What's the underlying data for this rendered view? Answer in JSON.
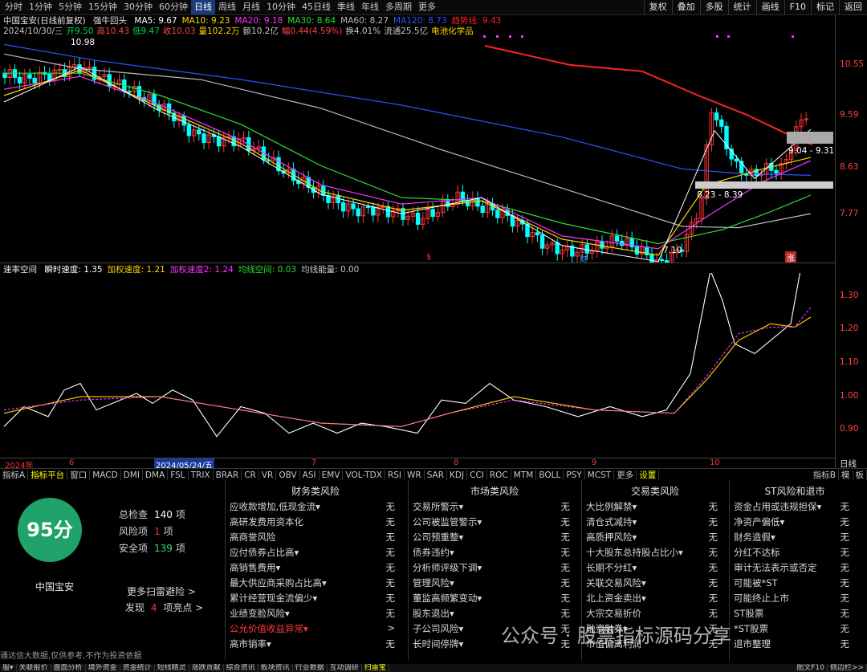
{
  "toolbar": {
    "periods": [
      "分时",
      "1分钟",
      "5分钟",
      "15分钟",
      "30分钟",
      "60分钟",
      "日线",
      "周线",
      "月线",
      "10分钟",
      "45日线",
      "季线",
      "年线",
      "多周期",
      "更多"
    ],
    "active_period": "日线",
    "right_tools": [
      "复权",
      "叠加",
      "多股",
      "统计",
      "画线",
      "F10",
      "标记",
      "返回"
    ]
  },
  "legend": {
    "stock_title": "中国宝安(日线前复权)",
    "signal": "强牛回头",
    "ma": [
      {
        "label": "MA5: 9.67",
        "color": "#ffffff"
      },
      {
        "label": "MA10: 9.23",
        "color": "#ffd700"
      },
      {
        "label": "MA20: 9.18",
        "color": "#ff33ff"
      },
      {
        "label": "MA30: 8.64",
        "color": "#33dd33"
      },
      {
        "label": "MA60: 8.27",
        "color": "#bbbbbb"
      },
      {
        "label": "MA120: 8.73",
        "color": "#2a55ff"
      },
      {
        "label": "趋势线: 9.43",
        "color": "#ff2222"
      }
    ],
    "ohlc": [
      {
        "t": "2024/10/30/三",
        "c": "#c8c8c8"
      },
      {
        "t": "开9.50",
        "c": "#00dd44"
      },
      {
        "t": "高10.43",
        "c": "#ff4444"
      },
      {
        "t": "低9.47",
        "c": "#00dd44"
      },
      {
        "t": "收10.03",
        "c": "#ff4444"
      },
      {
        "t": "量102.2万",
        "c": "#ffd700"
      },
      {
        "t": "额10.2亿",
        "c": "#c8c8c8"
      },
      {
        "t": "幅0.44(4.59%)",
        "c": "#ff4444"
      },
      {
        "t": "换4.01%",
        "c": "#c8c8c8"
      },
      {
        "t": "流通25.5亿",
        "c": "#c8c8c8"
      },
      {
        "t": "电池化学品",
        "c": "#ffd700"
      }
    ]
  },
  "price_axis": {
    "labels": [
      "10.55",
      "9.59",
      "8.63",
      "7.77"
    ]
  },
  "annotations": {
    "high_label": "10.98",
    "low_label": "7.10",
    "box1": "9.04 - 9.31",
    "box2": "8.23 - 8.39",
    "markers": [
      "$",
      "财",
      "涨"
    ]
  },
  "indicator": {
    "name": "速率空间",
    "items": [
      {
        "label": "瞬时速度: 1.35",
        "color": "#ffffff"
      },
      {
        "label": "加权速度: 1.21",
        "color": "#ffd700"
      },
      {
        "label": "加权速度2: 1.24",
        "color": "#ff33ff"
      },
      {
        "label": "均线空间: 0.03",
        "color": "#33dd33"
      },
      {
        "label": "均线能量: 0.00",
        "color": "#c8c8c8"
      }
    ],
    "axis": [
      "1.30",
      "1.20",
      "1.10",
      "1.00",
      "0.90"
    ]
  },
  "timeline": {
    "labels": [
      "2024年",
      "6",
      "2024/05/24/五",
      "7",
      "8",
      "9",
      "10"
    ],
    "right": "日线"
  },
  "tabs": {
    "items": [
      "指标A",
      "指标平台",
      "窗口",
      "MACD",
      "DMI",
      "DMA",
      "FSL",
      "TRIX",
      "BRAR",
      "CR",
      "VR",
      "OBV",
      "ASI",
      "EMV",
      "VOL-TDX",
      "RSI",
      "WR",
      "SAR",
      "KDJ",
      "CCI",
      "ROC",
      "MTM",
      "BOLL",
      "PSY",
      "MCST",
      "更多",
      "设置"
    ],
    "right": [
      "指标B",
      "模",
      "板"
    ]
  },
  "risk": {
    "score": "95分",
    "stock": "中国宝安",
    "stats": [
      {
        "label": "总检查",
        "num": "140",
        "unit": "项",
        "color": "#ffffff"
      },
      {
        "label": "风险项",
        "num": "1",
        "unit": "项",
        "color": "#ff3333"
      },
      {
        "label": "安全项",
        "num": "139",
        "unit": "项",
        "color": "#33dd66"
      }
    ],
    "more": "更多扫雷避险 >",
    "highlights": {
      "pre": "发现",
      "num": "4",
      "post": "项亮点 >"
    },
    "columns": [
      {
        "title": "财务类风险",
        "rows": [
          {
            "name": "应收款增加,低现金流▾",
            "v": "无"
          },
          {
            "name": "高研发费用资本化",
            "v": "无"
          },
          {
            "name": "高商誉风险",
            "v": "无"
          },
          {
            "name": "应付债券占比高▾",
            "v": "无"
          },
          {
            "name": "高销售费用▾",
            "v": "无"
          },
          {
            "name": "最大供应商采购占比高▾",
            "v": "无"
          },
          {
            "name": "累计经营现金流偏少▾",
            "v": "无"
          },
          {
            "name": "业绩变脸风险▾",
            "v": "无"
          },
          {
            "name": "公允价值收益异常▾",
            "v": ">",
            "red": true
          },
          {
            "name": "高市销率▾",
            "v": "无"
          }
        ]
      },
      {
        "title": "市场类风险",
        "rows": [
          {
            "name": "交易所警示▾",
            "v": "无"
          },
          {
            "name": "公司被监管警示▾",
            "v": "无"
          },
          {
            "name": "公司预重整▾",
            "v": "无"
          },
          {
            "name": "债券违约▾",
            "v": "无"
          },
          {
            "name": "分析师评级下调▾",
            "v": "无"
          },
          {
            "name": "管理风险▾",
            "v": "无"
          },
          {
            "name": "董监高频繁变动▾",
            "v": "无"
          },
          {
            "name": "股东退出▾",
            "v": "无"
          },
          {
            "name": "子公司风险▾",
            "v": "无"
          },
          {
            "name": "长时间停牌▾",
            "v": "无"
          }
        ]
      },
      {
        "title": "交易类风险",
        "rows": [
          {
            "name": "大比例解禁▾",
            "v": "无"
          },
          {
            "name": "清仓式减持▾",
            "v": "无"
          },
          {
            "name": "高质押风险▾",
            "v": "无"
          },
          {
            "name": "十大股东总持股占比小▾",
            "v": "无"
          },
          {
            "name": "长期不分红▾",
            "v": "无"
          },
          {
            "name": "关联交易风险▾",
            "v": "无"
          },
          {
            "name": "北上资金卖出▾",
            "v": "无"
          },
          {
            "name": "大宗交易折价",
            "v": "无"
          },
          {
            "name": "融资融券▾",
            "v": "无"
          },
          {
            "name": "市值偏离利润",
            "v": "无"
          }
        ]
      },
      {
        "title": "ST风险和退市",
        "rows": [
          {
            "name": "资金占用或违规担保▾",
            "v": "无"
          },
          {
            "name": "净资产偏低▾",
            "v": "无"
          },
          {
            "name": "财务造假▾",
            "v": "无"
          },
          {
            "name": "分红不达标",
            "v": "无"
          },
          {
            "name": "审计无法表示或否定",
            "v": "无"
          },
          {
            "name": "可能被*ST",
            "v": "无"
          },
          {
            "name": "可能终止上市",
            "v": "无"
          },
          {
            "name": "ST股票",
            "v": "无"
          },
          {
            "name": "*ST股票",
            "v": "无"
          },
          {
            "name": "退市整理",
            "v": "无"
          }
        ]
      }
    ],
    "disclaimer": "通达信大数据,仅供参考,不作为投资依据",
    "watermark": "公众号 · 股票指标源码分享"
  },
  "bottom_tabs": [
    "服▾",
    "关联报价",
    "盘面分析",
    "境外资金",
    "资金统计",
    "短线精灵",
    "涨跌贡献",
    "综合资讯",
    "板块资讯",
    "行业数据",
    "互动调研",
    "扫雷宝",
    "",
    "图文F10",
    "侧边栏>>"
  ],
  "bottom_active": "扫雷宝",
  "colors": {
    "up": "#ff3333",
    "down": "#00ffff",
    "accent": "#1fa36a"
  }
}
